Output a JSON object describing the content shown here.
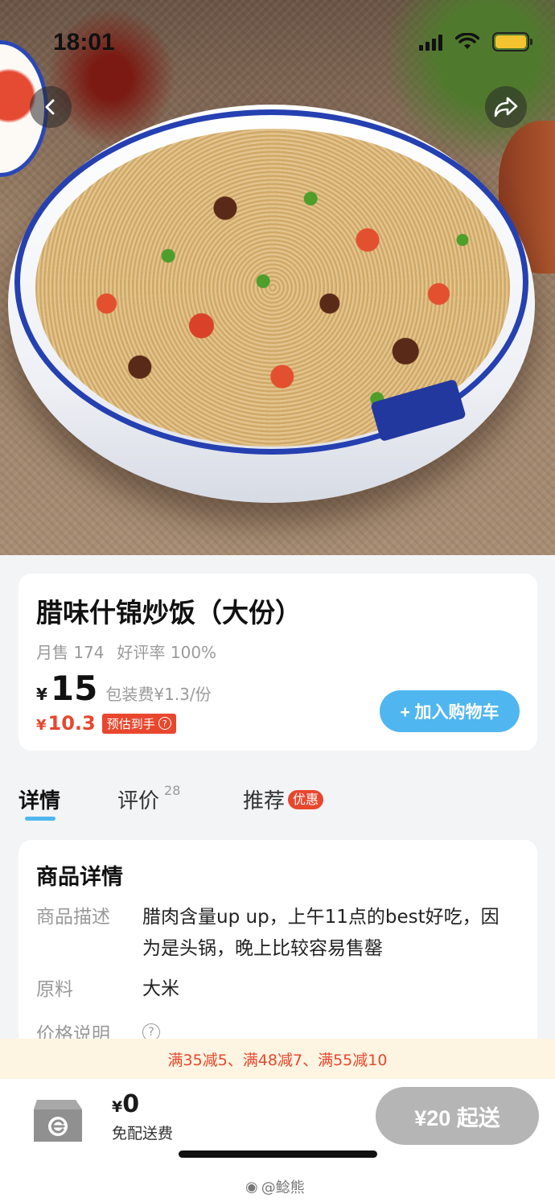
{
  "status_bar": {
    "time": "18:01"
  },
  "product": {
    "name": "腊味什锦炒饭（大份）",
    "monthly_sales": "月售 174",
    "rating": "好评率 100%",
    "currency": "¥",
    "price": "15",
    "packaging_fee": "包装费¥1.3/份",
    "estimated_price": "10.3",
    "estimated_tag": "预估到手",
    "add_to_cart": "+ 加入购物车"
  },
  "tabs": [
    {
      "label": "详情",
      "active": true
    },
    {
      "label": "评价",
      "count": "28"
    },
    {
      "label": "推荐",
      "badge": "优惠"
    }
  ],
  "details": {
    "title": "商品详情",
    "description_label": "商品描述",
    "description": "腊肉含量up up，上午11点的best好吃，因为是头锅，晚上比较容易售罄",
    "material_label": "原料",
    "material": "大米",
    "price_note_label": "价格说明"
  },
  "promo": {
    "text": "满35减5、满48减7、满55减10"
  },
  "bottom_bar": {
    "currency": "¥",
    "cart_total": "0",
    "delivery_fee": "免配送费",
    "min_order": "¥20 起送"
  },
  "watermark": "@鲶熊",
  "colors": {
    "accent_blue": "#4fb6f0",
    "price_red": "#e8472e",
    "promo_bg": "#fdf4e1",
    "disabled_gray": "#b5b5b5"
  }
}
